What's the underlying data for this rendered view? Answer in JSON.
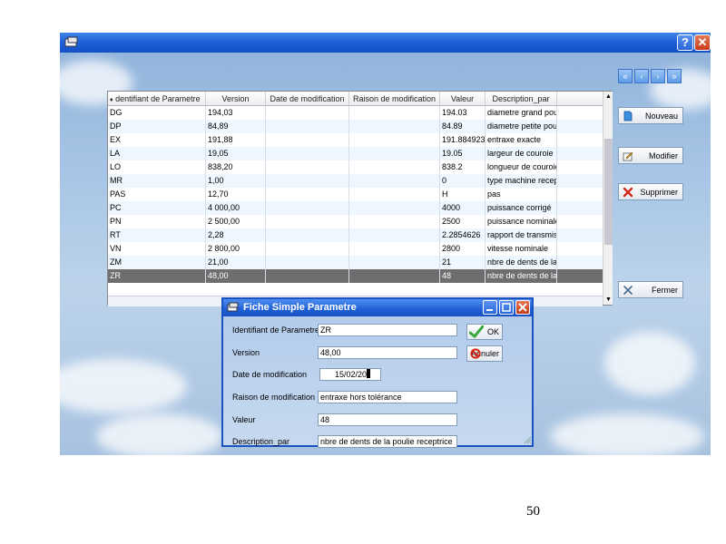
{
  "window": {
    "help_glyph": "?",
    "close_glyph": "✕"
  },
  "nav": [
    "«",
    "‹",
    "›",
    "»"
  ],
  "actions": {
    "new_label": "Nouveau",
    "modify_label": "Modifier",
    "delete_label": "Supprimer",
    "close_label": "Fermer"
  },
  "grid": {
    "columns": [
      "dentifiant de Parametre",
      "Version",
      "Date de modification",
      "Raison de modification",
      "Valeur",
      "Description_par"
    ],
    "rows": [
      [
        "DG",
        "194,03",
        "",
        "",
        "194.03",
        "diametre grand poul"
      ],
      [
        "DP",
        "84,89",
        "",
        "",
        "84.89",
        "diametre petite pouli"
      ],
      [
        "EX",
        "191,88",
        "",
        "",
        "191.884923",
        "entraxe exacte"
      ],
      [
        "LA",
        "19,05",
        "",
        "",
        "19.05",
        "largeur de couroie"
      ],
      [
        "LO",
        "838,20",
        "",
        "",
        "838.2",
        "longueur de couroie"
      ],
      [
        "MR",
        "1,00",
        "",
        "",
        "0",
        "type machine recep"
      ],
      [
        "PAS",
        "12,70",
        "",
        "",
        "H",
        "pas"
      ],
      [
        "PC",
        "4 000,00",
        "",
        "",
        "4000",
        "puissance corrigé"
      ],
      [
        "PN",
        "2 500,00",
        "",
        "",
        "2500",
        "puissance nominale"
      ],
      [
        "RT",
        "2,28",
        "",
        "",
        "2.2854626",
        "rapport de transmiss"
      ],
      [
        "VN",
        "2 800,00",
        "",
        "",
        "2800",
        "vitesse nominale"
      ],
      [
        "ZM",
        "21,00",
        "",
        "",
        "21",
        "nbre de dents de la"
      ],
      [
        "ZR",
        "48,00",
        "",
        "",
        "48",
        "nbre de dents de la"
      ]
    ],
    "selected_index": 12
  },
  "dialog": {
    "title": "Fiche Simple Parametre",
    "ok_label": "OK",
    "cancel_label": "Annuler",
    "fields": [
      {
        "label": "Identifiant de Parametre",
        "value": "ZR"
      },
      {
        "label": "Version",
        "value": "48,00"
      },
      {
        "label": "Date de modification",
        "value": "15/02/20"
      },
      {
        "label": "Raison de modification",
        "value": "entraxe hors tolérance"
      },
      {
        "label": "Valeur",
        "value": "48"
      },
      {
        "label": "Description_par",
        "value": "nbre de dents de la poulie receptrice"
      }
    ]
  },
  "page_number": "50",
  "colors": {
    "titlebar": "#1c5fd6",
    "selected_row": "#6e6e6e",
    "delete_red": "#d42a1a",
    "ok_green": "#3aa83a"
  }
}
